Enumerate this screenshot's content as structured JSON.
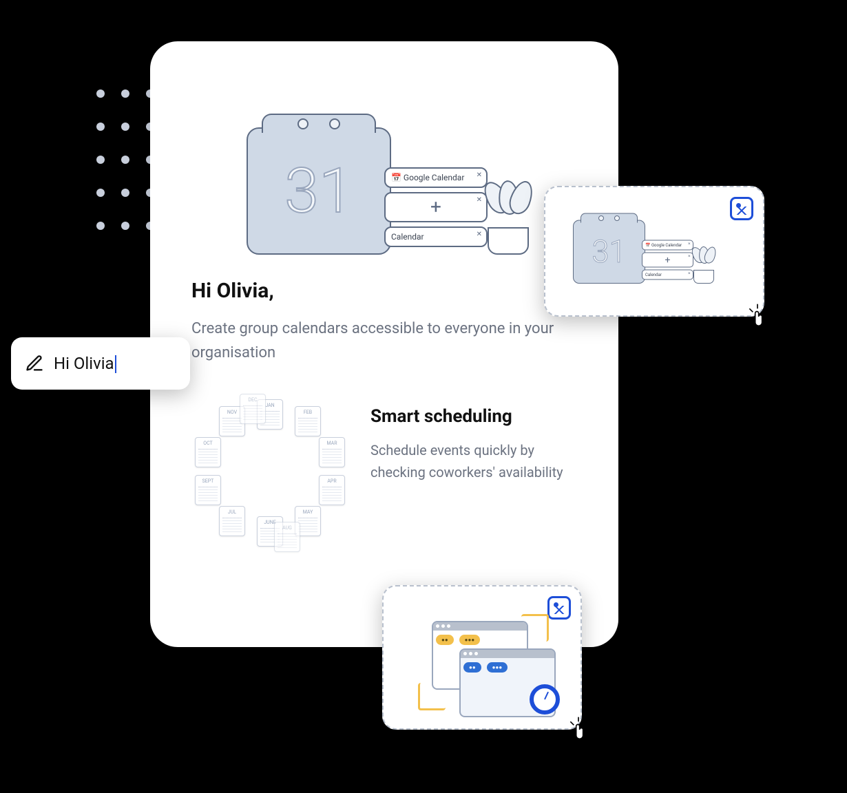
{
  "hero": {
    "calendar_number": "31",
    "card_google": "Google Calendar",
    "card_plus": "+",
    "card_calendar": "Calendar"
  },
  "greeting": {
    "title": "Hi Olivia,",
    "body": "Create group calendars accessible to everyone in your organisation"
  },
  "feature": {
    "title": "Smart scheduling",
    "body": "Schedule events quickly by checking coworkers' availability",
    "months": [
      "JAN",
      "FEB",
      "MAR",
      "APR",
      "MAY",
      "JUNE",
      "JUL",
      "AUG",
      "SEPT",
      "OCT",
      "NOV",
      "DEC"
    ]
  },
  "edit_pill": {
    "text": "Hi Olivia"
  },
  "dropzone_preview": {
    "calendar_number": "31",
    "card_google": "Google Calendar",
    "card_plus": "+",
    "card_calendar": "Calendar"
  }
}
